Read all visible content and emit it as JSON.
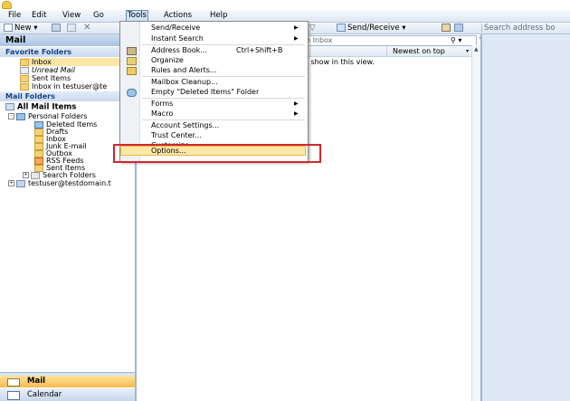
{
  "menubar": {
    "items": [
      "File",
      "Edit",
      "View",
      "Go",
      "Tools",
      "Actions",
      "Help"
    ],
    "selected": "Tools"
  },
  "toolbar": {
    "new_label": "New",
    "send_receive_label": "Send/Receive",
    "search_placeholder": "Search address bo"
  },
  "navpane": {
    "title": "Mail",
    "favorites_header": "Favorite Folders",
    "favorites": [
      "Inbox",
      "Unread Mail",
      "Sent Items",
      "Inbox in testuser@te"
    ],
    "mail_folders_header": "Mail Folders",
    "all_mail_items": "All Mail Items",
    "personal_folders": "Personal Folders",
    "folders": [
      "Deleted Items",
      "Drafts",
      "Inbox",
      "Junk E-mail",
      "Outbox",
      "RSS Feeds",
      "Sent Items",
      "Search Folders"
    ],
    "account": "testuser@testdomain.t",
    "nav_mail": "Mail",
    "nav_calendar": "Calendar"
  },
  "listpane": {
    "search_text": "h Inbox",
    "sort_label": "Newest on top",
    "empty_message": "o show in this view."
  },
  "tools_menu": {
    "items": [
      {
        "label": "Send/Receive",
        "submenu": true
      },
      {
        "label": "Instant Search",
        "submenu": true
      },
      {
        "label": "Address Book...",
        "shortcut": "Ctrl+Shift+B"
      },
      {
        "label": "Organize"
      },
      {
        "label": "Rules and Alerts..."
      },
      {
        "label": "Mailbox Cleanup..."
      },
      {
        "label": "Empty \"Deleted Items\" Folder"
      },
      {
        "label": "Forms",
        "submenu": true
      },
      {
        "label": "Macro",
        "submenu": true
      },
      {
        "label": "Account Settings..."
      },
      {
        "label": "Trust Center..."
      },
      {
        "label": "Customize..."
      },
      {
        "label": "Options...",
        "highlighted": true
      }
    ]
  },
  "colors": {
    "highlight_box": "#d3262c",
    "accent": "#15428b"
  }
}
